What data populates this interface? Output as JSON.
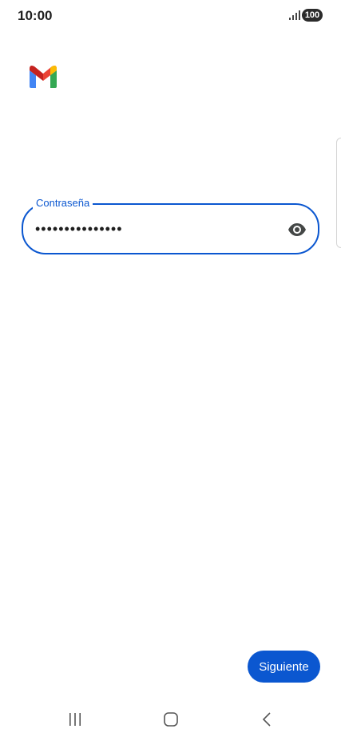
{
  "status_bar": {
    "time": "10:00",
    "battery": "100",
    "icons": [
      "signal-icon",
      "battery-icon"
    ]
  },
  "app": {
    "logo": "gmail-logo",
    "logo_colors": {
      "blue": "#4285F4",
      "red": "#EA4335",
      "yellow": "#FBBC04",
      "green": "#34A853",
      "dark_red": "#C5221F"
    }
  },
  "password_field": {
    "label": "Contraseña",
    "value": "•••••••••••••••",
    "toggle_icon": "eye-icon"
  },
  "actions": {
    "next_label": "Siguiente"
  },
  "nav": {
    "icons": [
      "recents-icon",
      "home-icon",
      "back-icon"
    ]
  },
  "colors": {
    "accent": "#0B57D0",
    "background": "#FFFFFF",
    "text": "#1F1F1F",
    "icon_gray": "#444746"
  }
}
